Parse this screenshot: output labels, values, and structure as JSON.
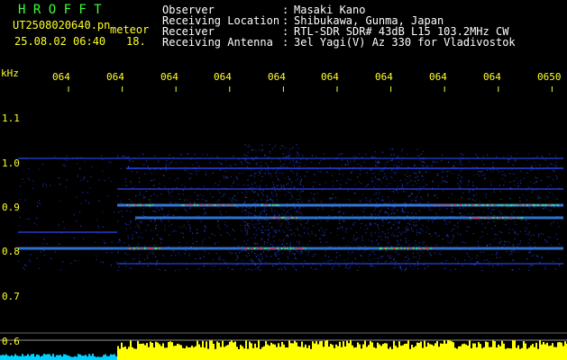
{
  "header": {
    "title": "H R O F F T",
    "filename": "UT2508020640.pn",
    "meteor_label": "meteor",
    "datetime": "25.08.02 06:40",
    "count": "18.",
    "info": [
      {
        "label": "Observer",
        "sep": ":",
        "value": "Masaki Kano"
      },
      {
        "label": "Receiving Location",
        "sep": ":",
        "value": "Shibukawa, Gunma, Japan"
      },
      {
        "label": "Receiver",
        "sep": ":",
        "value": "RTL-SDR SDR# 43dB L15 103.2MHz CW"
      },
      {
        "label": "Receiving Antenna",
        "sep": ":",
        "value": "3el Yagi(V) Az 330 for Vladivostok"
      }
    ]
  },
  "axis": {
    "unit": "kHz",
    "y_ticks": [
      "1.1",
      "1.0",
      "0.9",
      "0.8",
      "0.7",
      "0.6"
    ],
    "x_ticks": [
      "064",
      "064",
      "064",
      "064",
      "064",
      "064",
      "064",
      "064",
      "064",
      "0650"
    ]
  },
  "colors": {
    "background": "#000000",
    "text_green": "#3dff3d",
    "text_yellow": "#ffff2a",
    "text_white": "#ffffff",
    "signal_blue": "#2a4cff",
    "signal_hot": "#ff3030",
    "power_bar": "#ffff00",
    "power_bar_low": "#00d0ff"
  }
}
